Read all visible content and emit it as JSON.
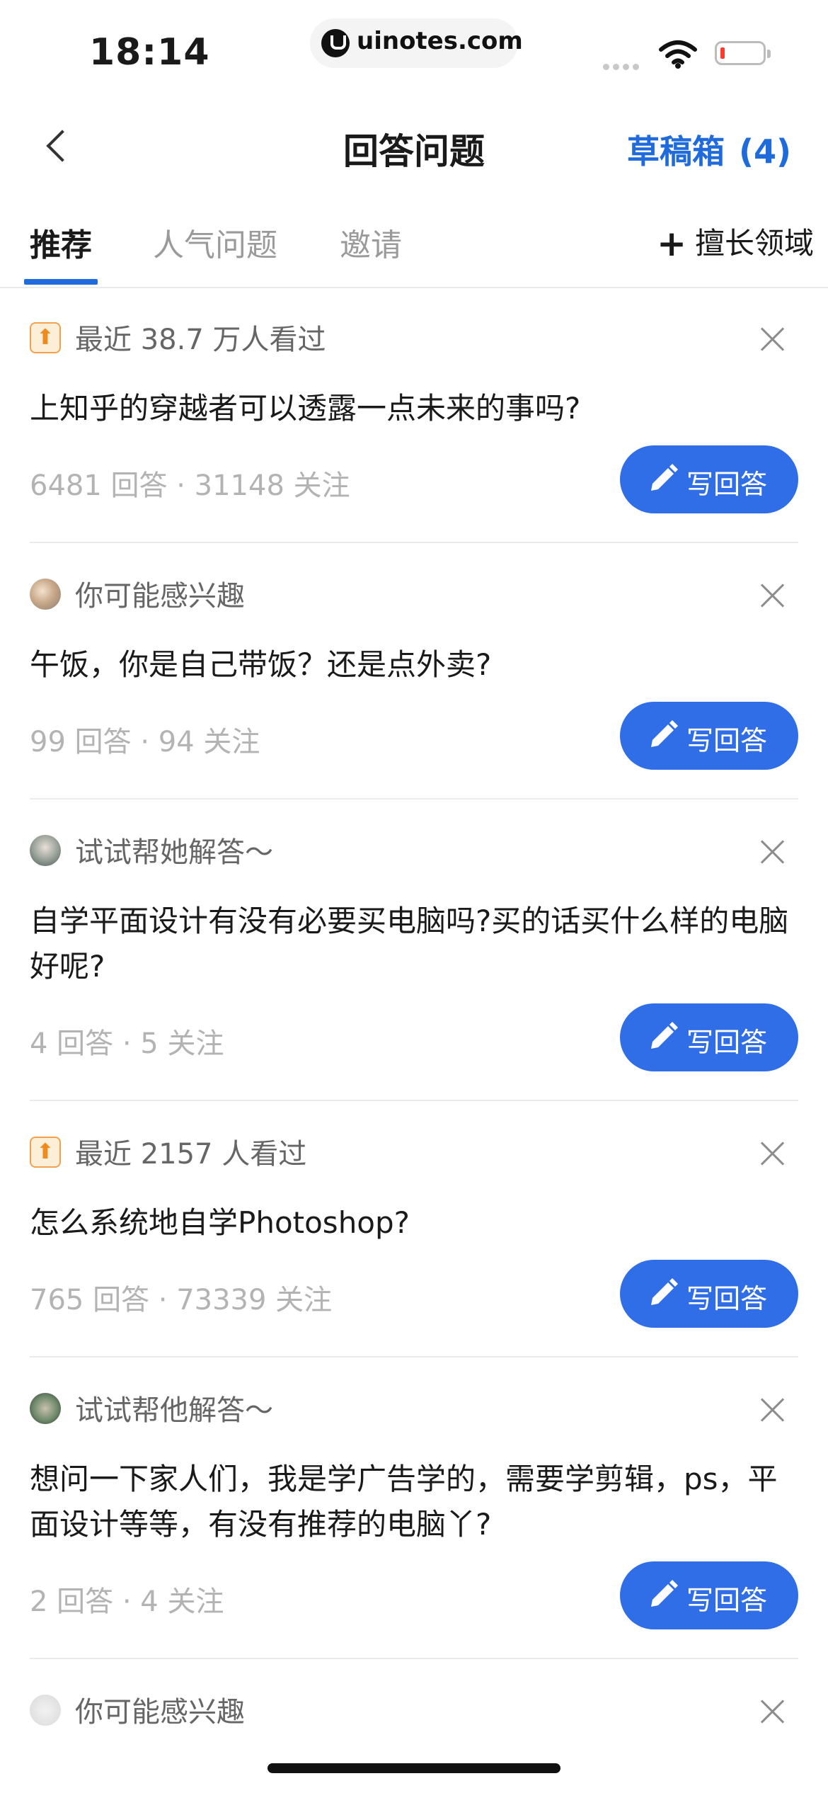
{
  "status_bar": {
    "time": "18:14",
    "url": "uinotes.com"
  },
  "header": {
    "back_icon": "chevron-left-icon",
    "title": "回答问题",
    "drafts_label": "草稿箱",
    "drafts_count": "(4)"
  },
  "tabs": [
    {
      "label": "推荐",
      "active": true
    },
    {
      "label": "人气问题",
      "active": false
    },
    {
      "label": "邀请",
      "active": false
    }
  ],
  "expertise": {
    "icon": "plus-icon",
    "label": "擅长领域"
  },
  "write_button_label": "写回答",
  "questions": [
    {
      "reason": "最近 38.7 万人看过",
      "reason_icon": "trending-up-icon",
      "title": "上知乎的穿越者可以透露一点未来的事吗?",
      "meta": "6481 回答 · 31148 关注"
    },
    {
      "reason": "你可能感兴趣",
      "reason_icon": "avatar-icon",
      "title": "午饭，你是自己带饭？还是点外卖?",
      "meta": "99 回答 · 94 关注"
    },
    {
      "reason": "试试帮她解答～",
      "reason_icon": "avatar-icon",
      "title": "自学平面设计有没有必要买电脑吗?买的话买什么样的电脑好呢?",
      "meta": "4 回答 · 5 关注"
    },
    {
      "reason": "最近 2157 人看过",
      "reason_icon": "trending-up-icon",
      "title": "怎么系统地自学Photoshop?",
      "meta": "765 回答 · 73339 关注"
    },
    {
      "reason": "试试帮他解答～",
      "reason_icon": "avatar-icon",
      "title": "想问一下家人们，我是学广告学的，需要学剪辑，ps，平面设计等等，有没有推荐的电脑丫?",
      "meta": "2 回答 · 4 关注"
    },
    {
      "reason": "你可能感兴趣",
      "reason_icon": "avatar-icon"
    }
  ],
  "colors": {
    "accent": "#2f6ee6",
    "link": "#1f6bdc",
    "muted": "#b3b3b3"
  }
}
